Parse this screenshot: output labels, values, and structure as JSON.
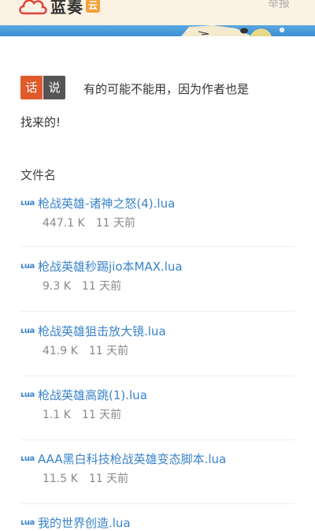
{
  "header": {
    "logo_text": "蓝奏",
    "logo_badge": "云",
    "report_label": "举报"
  },
  "notice": {
    "tag_1": "话",
    "tag_2": "说",
    "line_1": "有的可能不能用，因为作者也是",
    "line_2": "找来的!"
  },
  "list": {
    "column_header": "文件名",
    "files": [
      {
        "icon": "ʟua",
        "name": "枪战英雄-诸神之怒(4).lua",
        "size": "447.1 K",
        "time": "11 天前"
      },
      {
        "icon": "ʟua",
        "name": "枪战英雄秒踢jio本MAX.lua",
        "size": "9.3 K",
        "time": "11 天前"
      },
      {
        "icon": "ʟua",
        "name": "枪战英雄狙击放大镜.lua",
        "size": "41.9 K",
        "time": "11 天前"
      },
      {
        "icon": "ʟua",
        "name": "枪战英雄高跳(1).lua",
        "size": "1.1 K",
        "time": "11 天前"
      },
      {
        "icon": "ʟua",
        "name": "AAA黑白科技枪战英雄变态脚本.lua",
        "size": "11.5 K",
        "time": "11 天前"
      },
      {
        "icon": "ʟua",
        "name": "我的世界创造.lua",
        "size": "",
        "time": ""
      }
    ]
  },
  "colors": {
    "accent_link": "#3a84c9",
    "tag_red": "#e05a2b",
    "tag_dark": "#555555",
    "header_bg": "#fbf2e4",
    "banner_blue": "#4a9ad9"
  }
}
